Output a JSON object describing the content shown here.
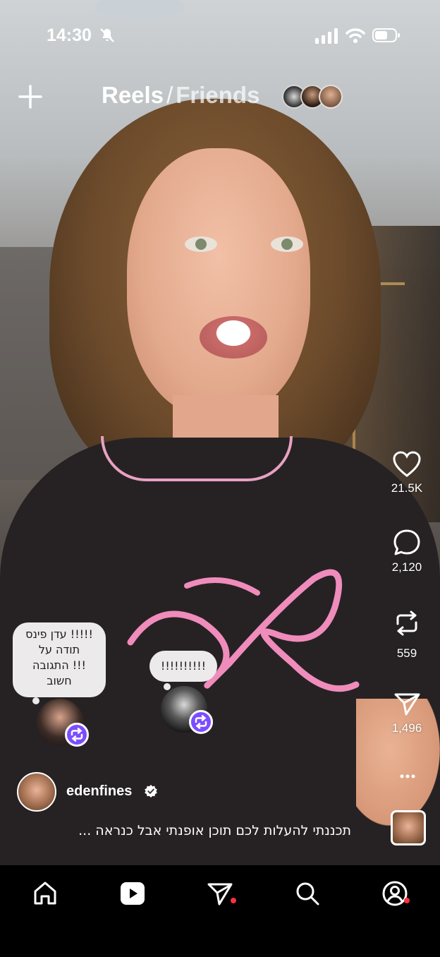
{
  "status_bar": {
    "time": "14:30"
  },
  "header": {
    "title": "Reels",
    "separator": "/",
    "subtitle": "Friends"
  },
  "actions": {
    "likes": "21.5K",
    "comments": "2,120",
    "reposts": "559",
    "shares": "1,496"
  },
  "notes": [
    {
      "text_line1": "עדן פינס !!!!!",
      "text_line2": "תודה על",
      "text_line3": "התגובה !!!",
      "text_line4": "חשוב"
    },
    {
      "text_line1": "!!!!!!!!!!"
    }
  ],
  "author": {
    "username": "edenfines"
  },
  "caption": "תכננתי להעלות לכם תוכן אופנתי אבל כנראה ...",
  "colors": {
    "accent_purple": "#7c4dff",
    "notification_red": "#ff3040"
  }
}
